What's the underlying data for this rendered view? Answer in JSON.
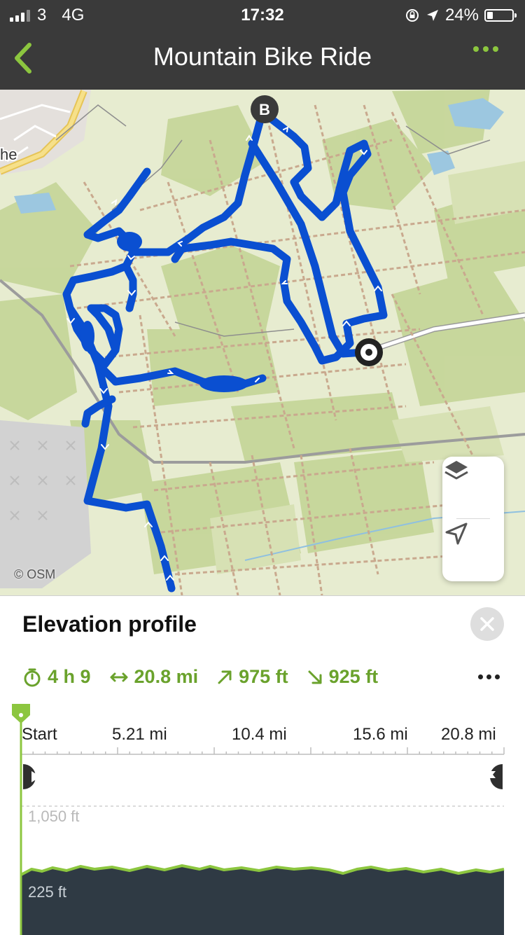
{
  "status_bar": {
    "carrier": "3",
    "network": "4G",
    "time": "17:32",
    "battery": "24%",
    "battery_level": 0.24
  },
  "nav": {
    "title": "Mountain Bike Ride",
    "back_icon": "chevron-left-icon",
    "more_icon": "more-icon"
  },
  "map": {
    "end_marker": "B",
    "attribution": "© OSM",
    "partial_place_label": "he",
    "layers_icon": "layers-icon",
    "locate_icon": "navigation-arrow-icon"
  },
  "panel": {
    "title": "Elevation profile",
    "close_icon": "close-icon",
    "stats": {
      "duration": "4 h 9",
      "distance": "20.8 mi",
      "ascent": "975 ft",
      "descent": "925 ft"
    },
    "distance_ticks": [
      "Start",
      "5.21 mi",
      "10.4 mi",
      "15.6 mi",
      "20.8 mi"
    ],
    "elevation_max": "1,050 ft",
    "elevation_min": "225 ft",
    "start_icon": "play-icon",
    "finish_icon": "flag-icon"
  },
  "colors": {
    "accent_green": "#8cc63f",
    "stat_green": "#6aa22c",
    "route_blue": "#0a4fd1",
    "top_bar": "#3a3a3a",
    "profile_fill": "#2f3a44"
  }
}
